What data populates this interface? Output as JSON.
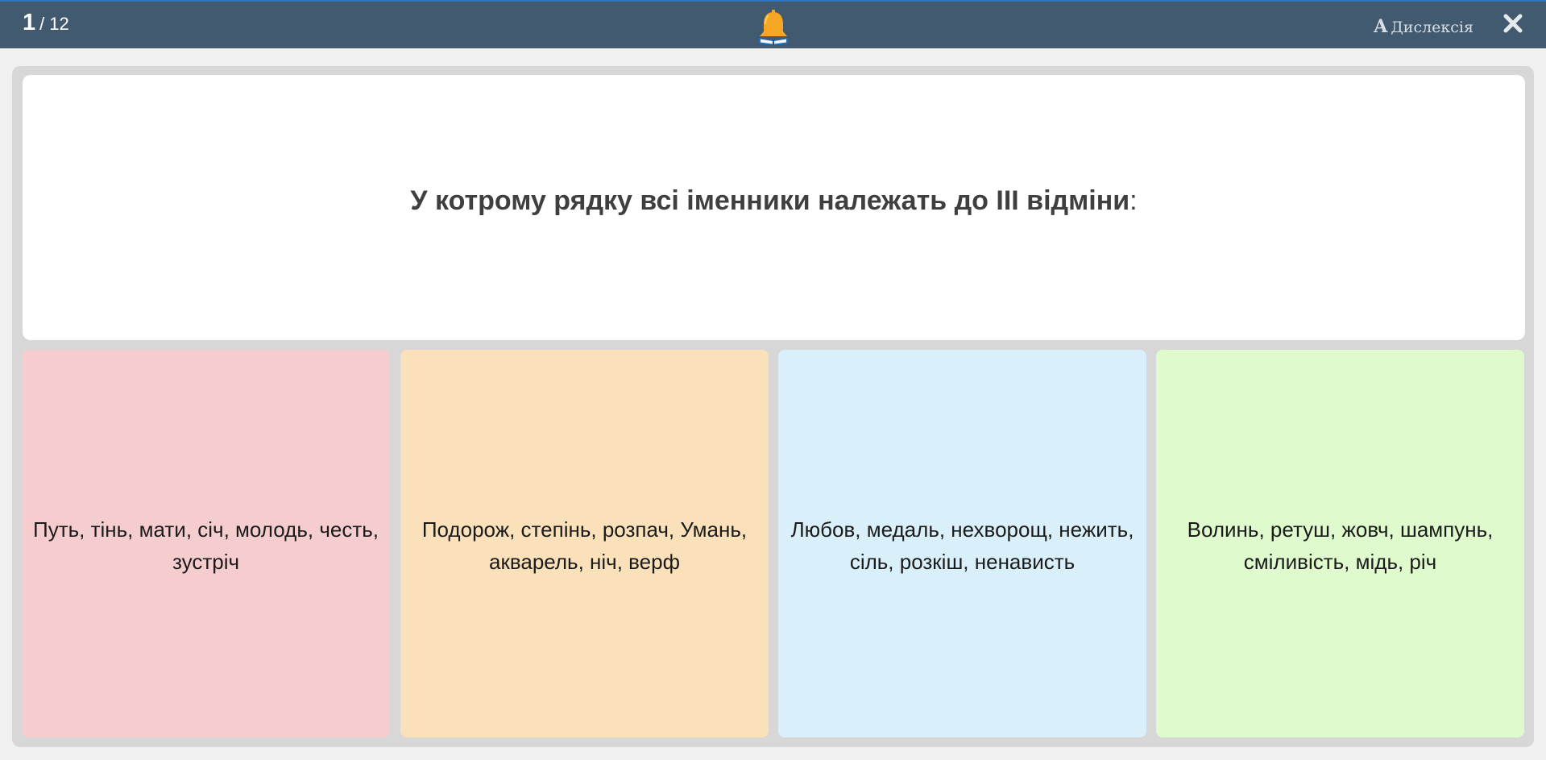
{
  "header": {
    "current": "1",
    "separator": "/",
    "total": "12",
    "dyslexia_glyph": "A",
    "dyslexia_label": "Дислексія",
    "bell_icon": "bell-icon",
    "close_icon": "close-icon"
  },
  "question": {
    "text": "У котрому рядку всі іменники належать до ІІІ відміни",
    "colon": ":"
  },
  "answers": [
    {
      "text": "Путь, тінь, мати, січ, молодь, честь, зустріч",
      "color": "#f6cdcf"
    },
    {
      "text": "Подорож, степінь, розпач, Умань, акварель, ніч, верф",
      "color": "#fae1b9"
    },
    {
      "text": "Любов, медаль, нехворощ, нежить, сіль, розкіш, ненависть",
      "color": "#d9eff9"
    },
    {
      "text": "Волинь, ретуш, жовч, шампунь, сміливість, мідь, річ",
      "color": "#dffacd"
    }
  ],
  "colors": {
    "topbar": "#425a6f",
    "panel": "#d7d7d7",
    "bell": "#f5a623"
  }
}
